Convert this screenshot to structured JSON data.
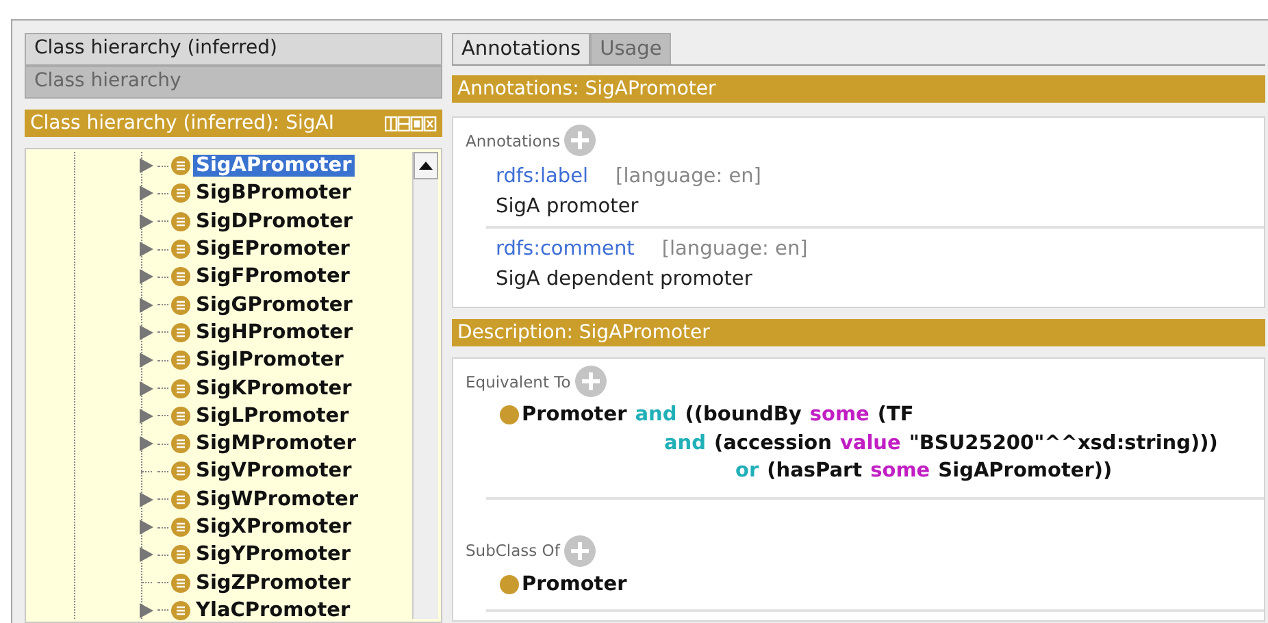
{
  "left_panel": {
    "view_tabs": [
      {
        "label": "Class hierarchy (inferred)",
        "selected": true
      },
      {
        "label": "Class hierarchy",
        "selected": false
      }
    ],
    "title": "Class hierarchy (inferred): SigAI",
    "tree": [
      {
        "label": "SigAPromoter",
        "expandable": true,
        "selected": true
      },
      {
        "label": "SigBPromoter",
        "expandable": true,
        "selected": false
      },
      {
        "label": "SigDPromoter",
        "expandable": true,
        "selected": false
      },
      {
        "label": "SigEPromoter",
        "expandable": true,
        "selected": false
      },
      {
        "label": "SigFPromoter",
        "expandable": true,
        "selected": false
      },
      {
        "label": "SigGPromoter",
        "expandable": true,
        "selected": false
      },
      {
        "label": "SigHPromoter",
        "expandable": true,
        "selected": false
      },
      {
        "label": "SigIPromoter",
        "expandable": true,
        "selected": false
      },
      {
        "label": "SigKPromoter",
        "expandable": true,
        "selected": false
      },
      {
        "label": "SigLPromoter",
        "expandable": true,
        "selected": false
      },
      {
        "label": "SigMPromoter",
        "expandable": true,
        "selected": false
      },
      {
        "label": "SigVPromoter",
        "expandable": false,
        "selected": false
      },
      {
        "label": "SigWPromoter",
        "expandable": true,
        "selected": false
      },
      {
        "label": "SigXPromoter",
        "expandable": true,
        "selected": false
      },
      {
        "label": "SigYPromoter",
        "expandable": true,
        "selected": false
      },
      {
        "label": "SigZPromoter",
        "expandable": false,
        "selected": false
      },
      {
        "label": "YlaCPromoter",
        "expandable": true,
        "selected": false
      }
    ]
  },
  "right_panel": {
    "tabs": [
      {
        "label": "Annotations",
        "selected": true
      },
      {
        "label": "Usage",
        "selected": false
      }
    ],
    "annotations": {
      "title": "Annotations: SigAPromoter",
      "section": "Annotations",
      "items": [
        {
          "property": "rdfs:label",
          "language": "[language: en]",
          "value": "SigA promoter"
        },
        {
          "property": "rdfs:comment",
          "language": "[language: en]",
          "value": "SigA dependent promoter"
        }
      ]
    },
    "description": {
      "title": "Description: SigAPromoter",
      "sections": [
        {
          "heading": "Equivalent To",
          "lines": [
            [
              {
                "text": "Promoter",
                "kind": "name"
              },
              {
                "text": "and",
                "kind": "connective"
              },
              {
                "text": "((boundBy",
                "kind": "name"
              },
              {
                "text": "some",
                "kind": "restriction"
              },
              {
                "text": "(TF",
                "kind": "name"
              }
            ],
            [
              {
                "text": "and",
                "kind": "connective"
              },
              {
                "text": "(accession",
                "kind": "name"
              },
              {
                "text": "value",
                "kind": "restriction"
              },
              {
                "text": "\"BSU25200\"^^xsd:string)))",
                "kind": "name"
              }
            ],
            [
              {
                "text": "or",
                "kind": "connective"
              },
              {
                "text": "(hasPart",
                "kind": "name"
              },
              {
                "text": "some",
                "kind": "restriction"
              },
              {
                "text": "SigAPromoter))",
                "kind": "name"
              }
            ]
          ]
        },
        {
          "heading": "SubClass Of",
          "lines": [
            [
              {
                "text": "Promoter",
                "kind": "name"
              }
            ]
          ]
        }
      ]
    }
  }
}
